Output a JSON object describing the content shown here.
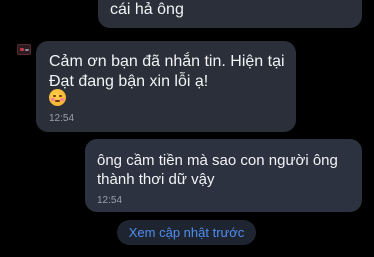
{
  "messages": [
    {
      "side": "outgoing",
      "text": "cái hả ông",
      "partial": true
    },
    {
      "side": "incoming",
      "text": "Cảm ơn bạn đã nhắn tin. Hiện tại Đạt đang bận xin lỗi ạ!",
      "emoji": "face-with-blush-hot-emoji",
      "time": "12:54"
    },
    {
      "side": "outgoing",
      "text": "ông cầm tiền mà sao con người ông thành thơi dữ vậy",
      "time": "12:54"
    }
  ],
  "load_more_label": "Xem cập nhật trước",
  "colors": {
    "background": "#000000",
    "bubble": "#2a2f3a",
    "accent": "#4f8df0",
    "timestamp": "#9aa0aa"
  }
}
